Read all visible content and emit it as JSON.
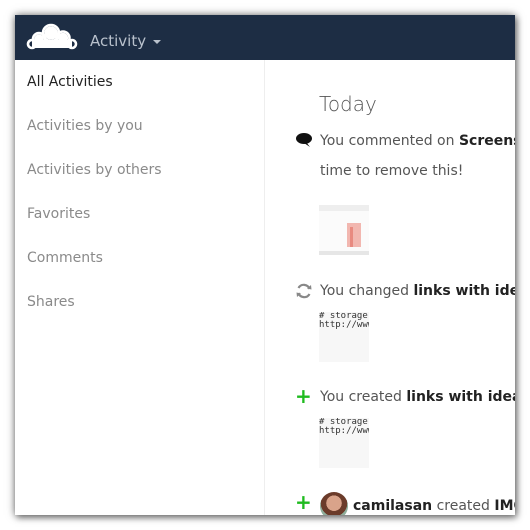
{
  "header": {
    "app_name": "Activity",
    "bar_color": "#1d2d44"
  },
  "sidebar": {
    "items": [
      {
        "label": "All Activities",
        "active": true
      },
      {
        "label": "Activities by you",
        "active": false
      },
      {
        "label": "Activities by others",
        "active": false
      },
      {
        "label": "Favorites",
        "active": false
      },
      {
        "label": "Comments",
        "active": false
      },
      {
        "label": "Shares",
        "active": false
      }
    ]
  },
  "main": {
    "section_title": "Today",
    "activities": [
      {
        "icon": "comment-icon",
        "prefix": "You commented on ",
        "object": "Screensh",
        "subtext": "time to remove this!"
      },
      {
        "icon": "sync-icon",
        "prefix": "You changed ",
        "object": "links with ideas",
        "preview": [
          "# storage i",
          "http://www"
        ]
      },
      {
        "icon": "plus-icon",
        "prefix": "You created ",
        "object": "links with ideas.",
        "preview": [
          "# storage i",
          "http://www"
        ]
      },
      {
        "icon": "plus-icon",
        "actor": "camilasan",
        "verb": " created ",
        "object": "IMG_"
      }
    ],
    "accent_green": "#1fbb1f"
  }
}
